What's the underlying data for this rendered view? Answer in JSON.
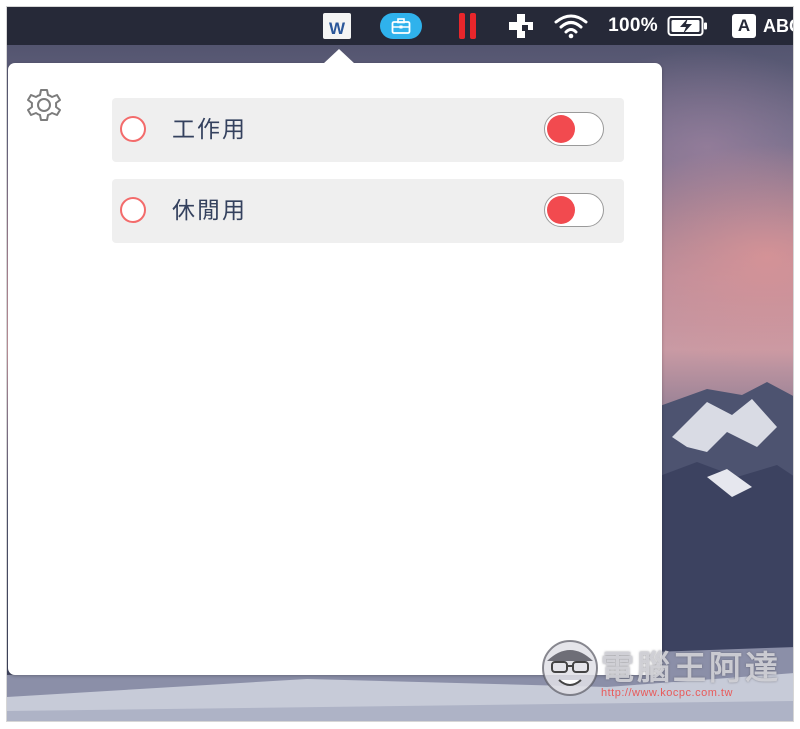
{
  "menubar": {
    "word_letter": "W",
    "battery_percent": "100%",
    "input_source_letter": "A",
    "input_source_name": "ABC",
    "icons": [
      "word-icon",
      "briefcase-icon",
      "pause-icon",
      "puzzle-icon",
      "wifi-icon",
      "battery-charging-icon",
      "input-source-icon"
    ]
  },
  "popover": {
    "settings_icon": "gear-icon",
    "profiles": [
      {
        "label": "工作用",
        "selected": false,
        "toggle_on": false
      },
      {
        "label": "休閒用",
        "selected": false,
        "toggle_on": false
      }
    ]
  },
  "watermark": {
    "title": "電腦王阿達",
    "url": "http://www.kocpc.com.tw"
  },
  "colors": {
    "menubar_bg": "#262938",
    "accent_red": "#f24a4f",
    "radio_border": "#f36b6b",
    "row_bg": "#efefef",
    "label_text": "#34415e",
    "briefcase_badge": "#2fb2ec"
  }
}
